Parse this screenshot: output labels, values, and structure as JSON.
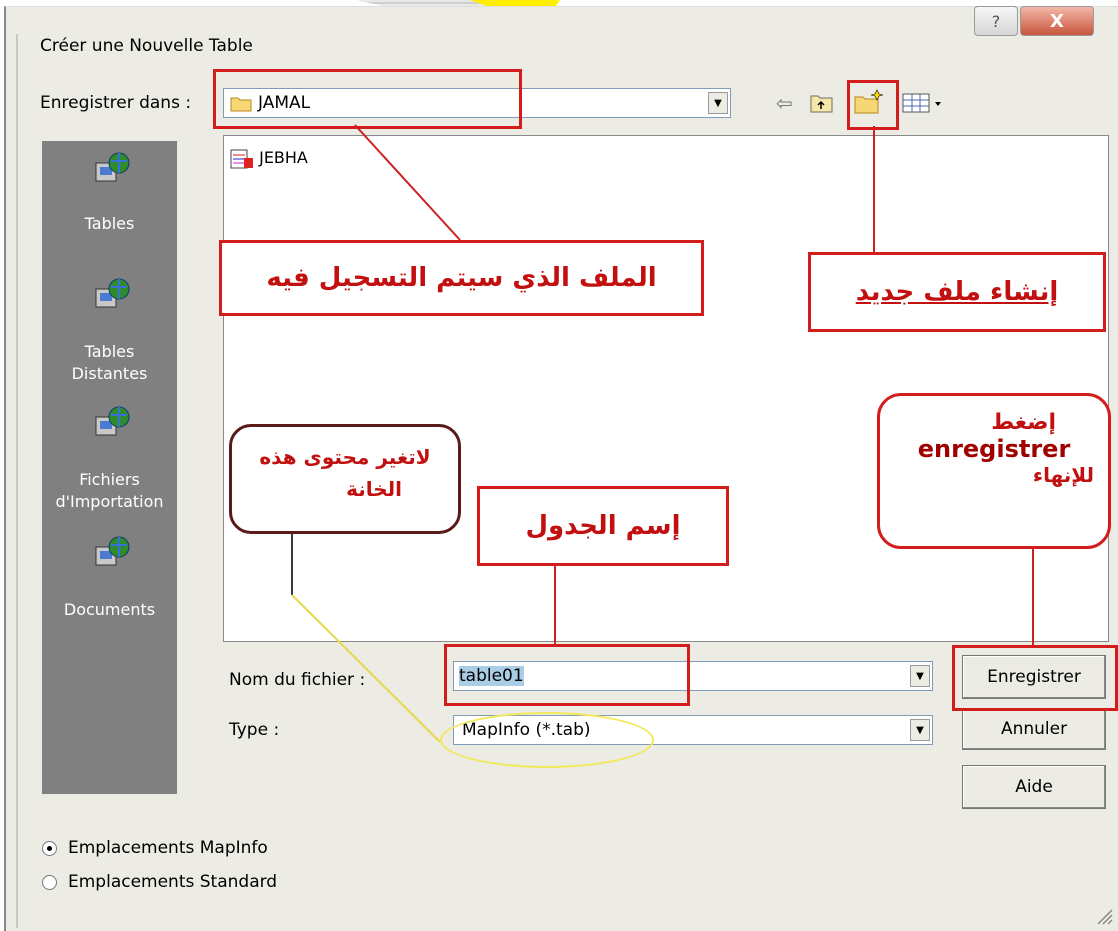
{
  "dialog": {
    "title": "Créer une Nouvelle Table",
    "help_glyph": "?",
    "close_glyph": "X"
  },
  "save_in": {
    "label": "Enregistrer dans :",
    "value": "JAMAL"
  },
  "places": [
    {
      "label": "Tables"
    },
    {
      "label": "Tables\nDistantes"
    },
    {
      "label": "Fichiers\nd'Importation"
    },
    {
      "label": "Documents"
    }
  ],
  "files": [
    {
      "name": "JEBHA"
    }
  ],
  "filename": {
    "label": "Nom du fichier :",
    "value": "table01"
  },
  "type": {
    "label": "Type :",
    "value": "MapInfo (*.tab)"
  },
  "buttons": {
    "save": "Enregistrer",
    "cancel": "Annuler",
    "help": "Aide"
  },
  "locations": {
    "mapinfo": "Emplacements MapInfo",
    "standard": "Emplacements Standard"
  },
  "annotations": {
    "folder_note": "الملف الذي سيتم التسجيل فيه",
    "new_folder_note": "إنشاء ملف جديد",
    "press_1": "إضغط",
    "press_2": "enregistrer",
    "press_3": "للإنهاء",
    "table_name_note": "إسم الجدول",
    "dont_change_1": "لاتغير محتوى هذه",
    "dont_change_2": "الخانة"
  },
  "colors": {
    "annotation_red": "#d31c1c",
    "annotation_yellow": "#f2e85a",
    "dialog_bg": "#ecebe4",
    "places_bg": "#808080"
  }
}
